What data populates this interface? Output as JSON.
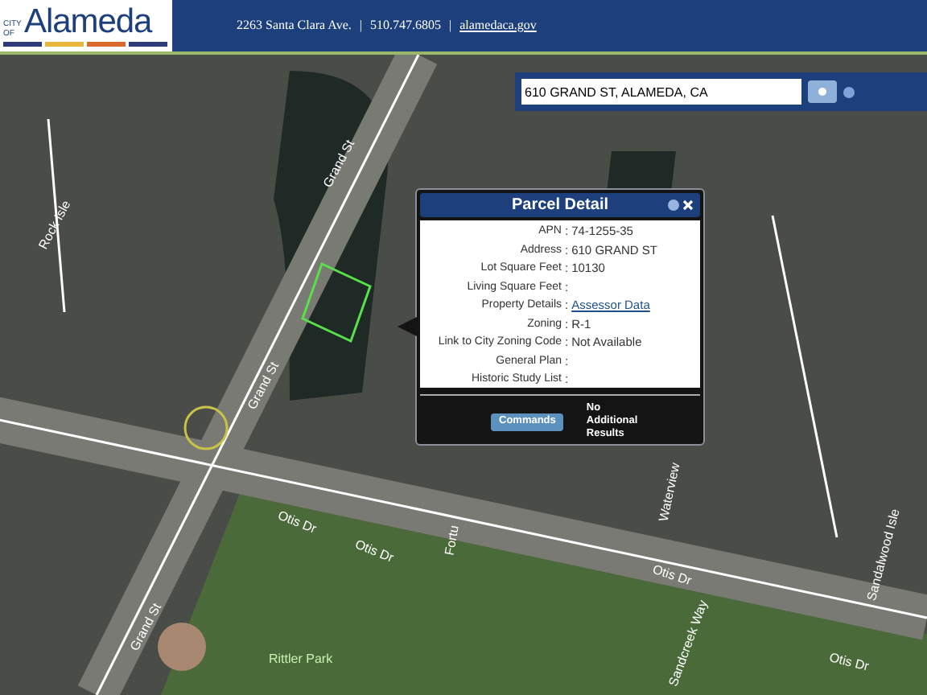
{
  "header": {
    "logo_small": "CITY OF",
    "logo_name": "Alameda",
    "address": "2263 Santa Clara Ave.",
    "phone": "510.747.6805",
    "website": "alamedaca.gov",
    "separators": [
      "|",
      "|"
    ]
  },
  "search": {
    "value": "610 GRAND ST, ALAMEDA, CA"
  },
  "map_labels": [
    {
      "text": "Rock Isle",
      "kind": "street"
    },
    {
      "text": "Grand St",
      "kind": "street"
    },
    {
      "text": "Grand St",
      "kind": "street"
    },
    {
      "text": "Grand St",
      "kind": "street"
    },
    {
      "text": "Otis Dr",
      "kind": "street"
    },
    {
      "text": "Otis Dr",
      "kind": "street"
    },
    {
      "text": "Otis Dr",
      "kind": "street"
    },
    {
      "text": "Otis Dr",
      "kind": "street"
    },
    {
      "text": "Fortu",
      "kind": "street"
    },
    {
      "text": "Waterview",
      "kind": "street"
    },
    {
      "text": "Sandalwood Isle",
      "kind": "street"
    },
    {
      "text": "Sandcreek Way",
      "kind": "street"
    },
    {
      "text": "Rittler Park",
      "kind": "park"
    }
  ],
  "popup": {
    "title": "Parcel Detail",
    "fields": [
      {
        "label": "APN",
        "separator": ":",
        "value": "74-1255-35",
        "kind": "text"
      },
      {
        "label": "Address",
        "separator": ":",
        "value": "610 GRAND ST",
        "kind": "text"
      },
      {
        "label": "Lot Square Feet",
        "separator": ":",
        "value": "10130",
        "kind": "text"
      },
      {
        "label": "Living Square Feet",
        "separator": ":"
      },
      {
        "label": "Property Details",
        "separator": ":",
        "value": "Assessor Data",
        "kind": "link"
      },
      {
        "label": "Zoning",
        "separator": ":",
        "value": "R-1",
        "kind": "text"
      },
      {
        "label": "Link to City Zoning Code",
        "separator": ":",
        "value": "Not Available",
        "kind": "text"
      },
      {
        "label": "General Plan",
        "separator": ":"
      },
      {
        "label": "Historic Study List",
        "separator": ":"
      }
    ],
    "commands_button": "Commands",
    "results_note": "No Additional Results"
  }
}
